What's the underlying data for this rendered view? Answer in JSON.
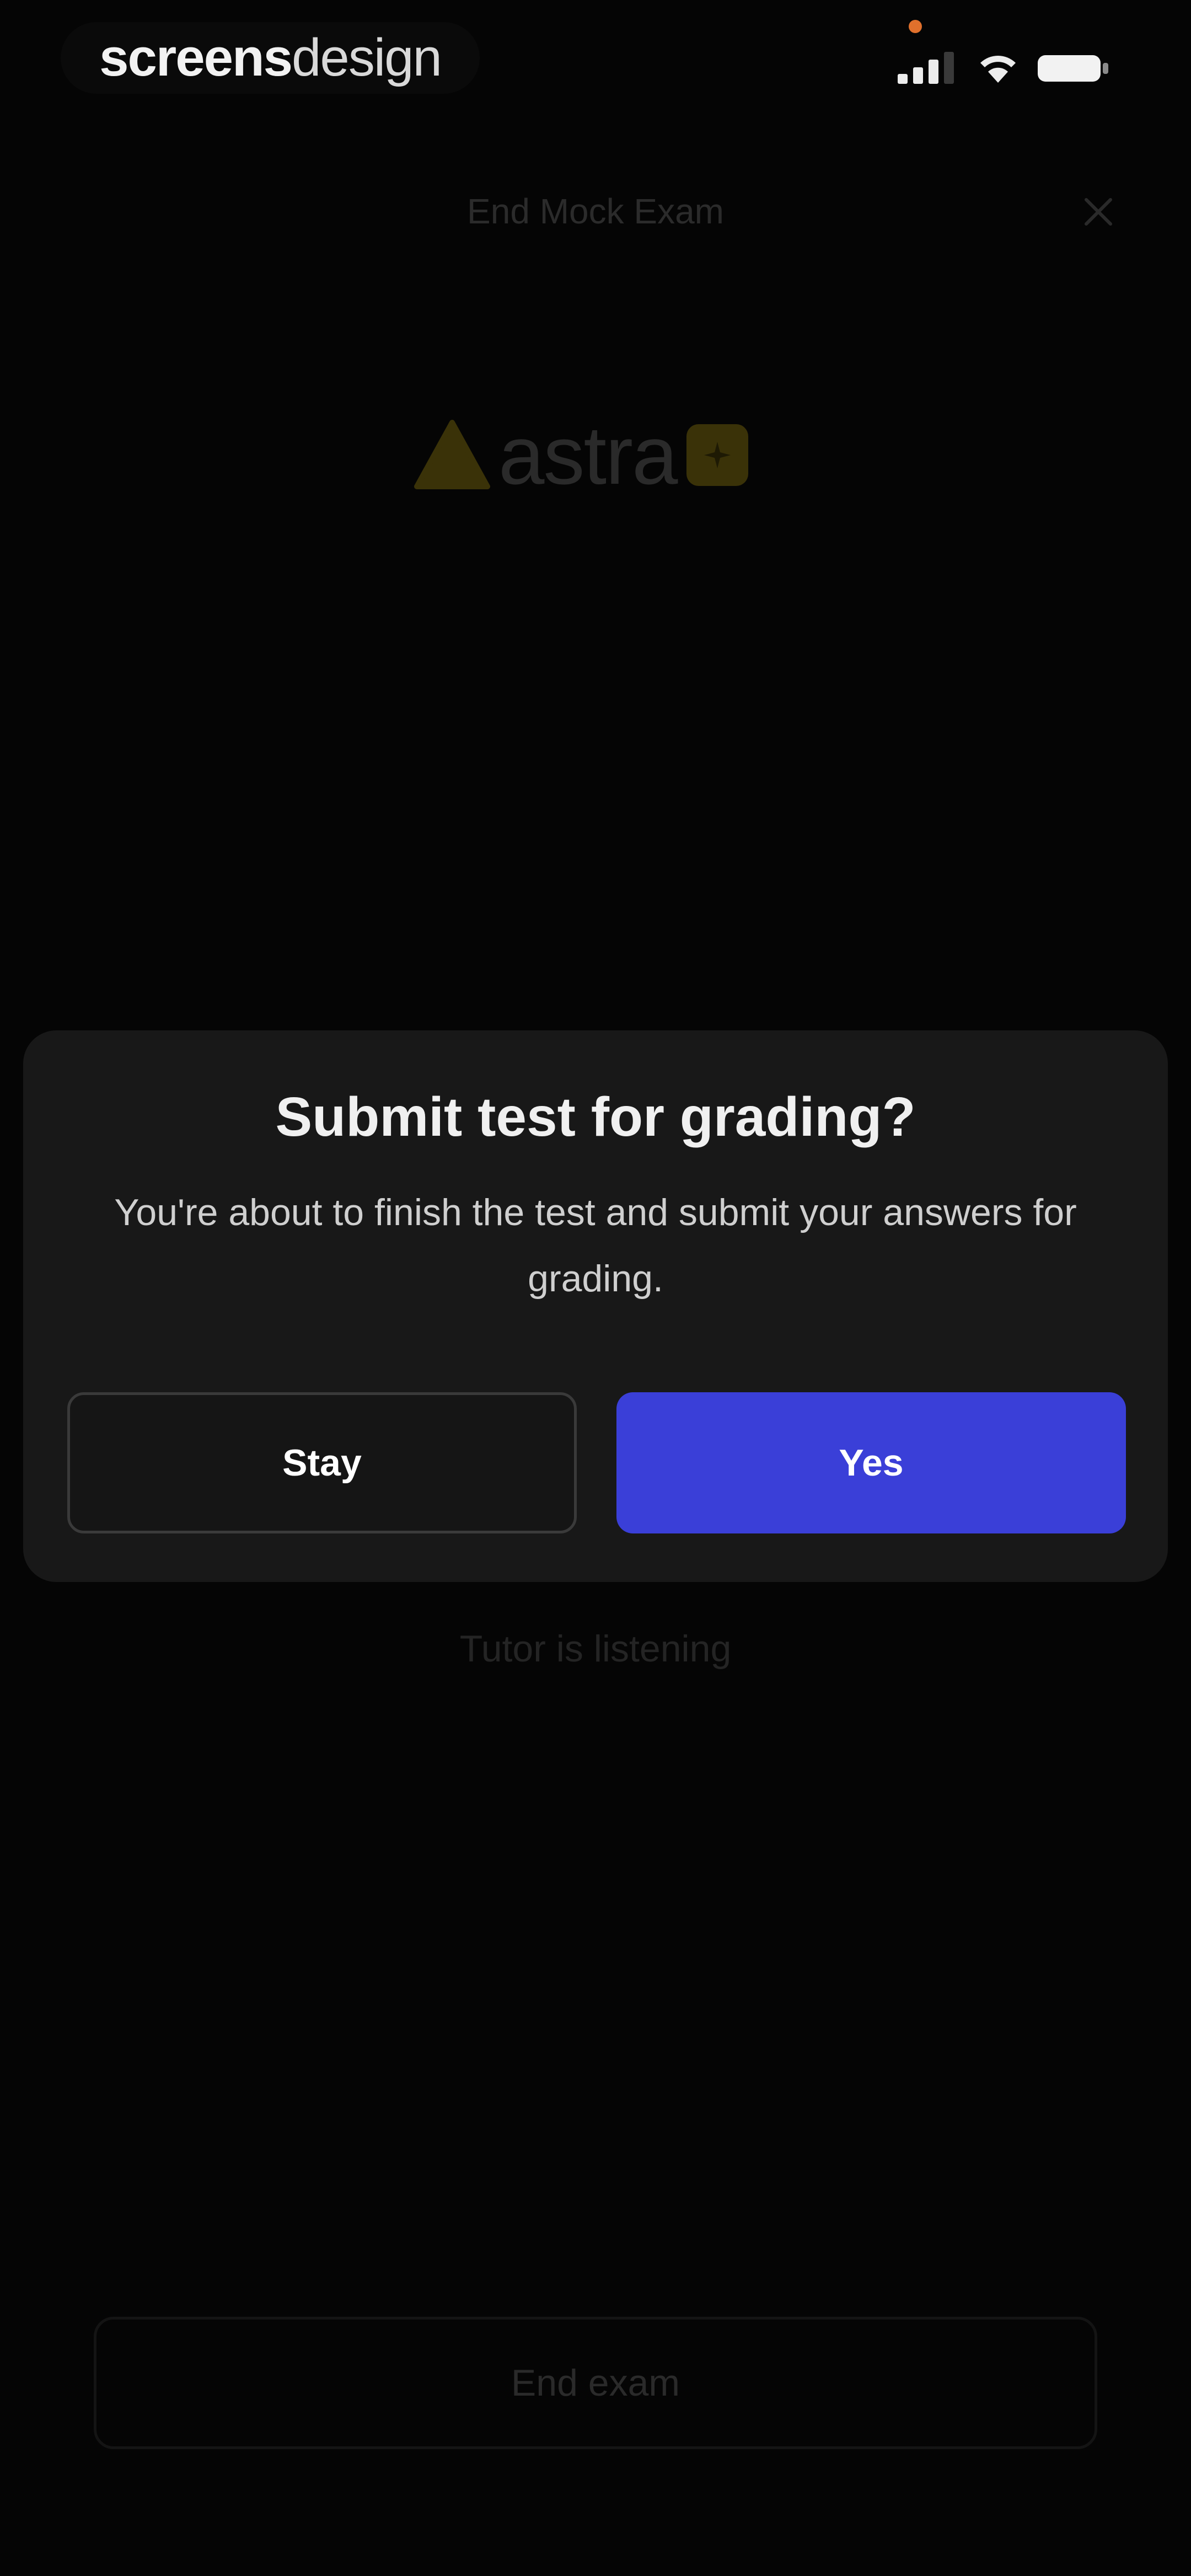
{
  "status_bar": {
    "brand_part1": "screens",
    "brand_part2": "design",
    "icons": [
      "signal-icon",
      "wifi-icon",
      "battery-icon"
    ]
  },
  "header": {
    "title": "End Mock Exam",
    "close_icon": "close-icon"
  },
  "logo": {
    "text": "astra",
    "badge_icon": "ai-badge-icon"
  },
  "dialog": {
    "title": "Submit test for grading?",
    "message": "You're about to finish the test and submit your answers for grading.",
    "stay_label": "Stay",
    "yes_label": "Yes"
  },
  "tutor_status": "Tutor is listening",
  "end_exam_label": "End exam",
  "colors": {
    "primary": "#3a3fd8",
    "dialog_bg": "#181818",
    "background": "#050505",
    "logo_accent": "#c9a21a"
  }
}
